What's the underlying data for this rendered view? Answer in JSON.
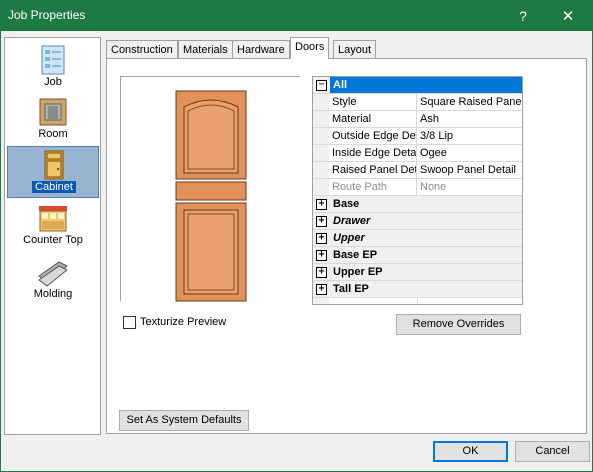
{
  "window": {
    "title": "Job Properties",
    "help_label": "?",
    "close_label": "✕",
    "titlebar_color": "#1e7a44"
  },
  "sidebar": {
    "items": [
      {
        "label": "Job",
        "icon": "job-document-icon"
      },
      {
        "label": "Room",
        "icon": "room-icon"
      },
      {
        "label": "Cabinet",
        "icon": "cabinet-icon",
        "selected": true
      },
      {
        "label": "Counter Top",
        "icon": "counter-top-icon"
      },
      {
        "label": "Molding",
        "icon": "molding-icon"
      }
    ]
  },
  "tabs": [
    {
      "label": "Construction"
    },
    {
      "label": "Materials"
    },
    {
      "label": "Hardware"
    },
    {
      "label": "Doors",
      "active": true
    },
    {
      "label": "Layout"
    }
  ],
  "property_grid": {
    "all_label": "All",
    "properties": [
      {
        "name": "Style",
        "value": "Square Raised Panel"
      },
      {
        "name": "Material",
        "value": "Ash"
      },
      {
        "name": "Outside Edge Detail",
        "value": "3/8 Lip"
      },
      {
        "name": "Inside Edge Detail",
        "value": "Ogee"
      },
      {
        "name": "Raised Panel Detail",
        "value": "Swoop Panel Detail"
      },
      {
        "name": "Route Path",
        "value": "None",
        "disabled": true
      }
    ],
    "categories": [
      {
        "label": "Base",
        "italic": false
      },
      {
        "label": "Drawer",
        "italic": true
      },
      {
        "label": "Upper",
        "italic": true
      },
      {
        "label": "Base EP",
        "italic": false
      },
      {
        "label": "Upper EP",
        "italic": false
      },
      {
        "label": "Tall EP",
        "italic": false
      }
    ],
    "expand_symbol": "+",
    "collapse_symbol": "−"
  },
  "texturize_preview": {
    "label": "Texturize Preview",
    "checked": false
  },
  "buttons": {
    "remove_overrides": "Remove Overrides",
    "set_defaults": "Set As System Defaults",
    "ok": "OK",
    "cancel": "Cancel"
  },
  "door_color": "#e3915a",
  "selection_color": "#0078d7"
}
